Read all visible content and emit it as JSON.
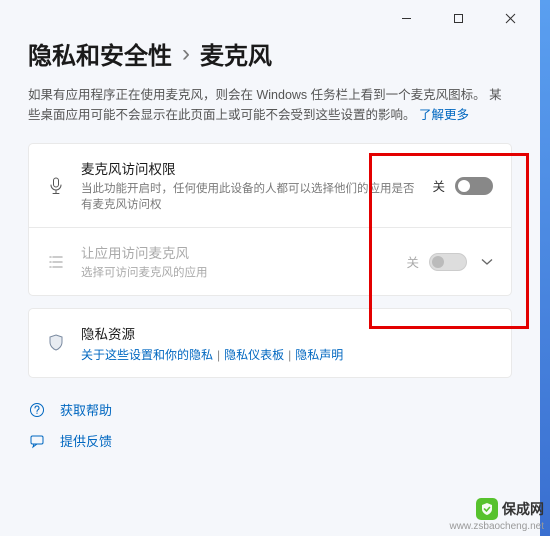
{
  "breadcrumb": {
    "parent": "隐私和安全性",
    "sep": "›",
    "current": "麦克风"
  },
  "description": {
    "text": "如果有应用程序正在使用麦克风，则会在 Windows 任务栏上看到一个麦克风图标。 某些桌面应用可能不会显示在此页面上或可能不会受到这些设置的影响。 ",
    "linkText": "了解更多"
  },
  "cards": {
    "access": {
      "title": "麦克风访问权限",
      "sub": "当此功能开启时，任何使用此设备的人都可以选择他们的应用是否有麦克风访问权",
      "state": "关"
    },
    "apps": {
      "title": "让应用访问麦克风",
      "sub": "选择可访问麦克风的应用",
      "state": "关"
    },
    "resources": {
      "title": "隐私资源",
      "links": [
        "关于这些设置和你的隐私",
        "隐私仪表板",
        "隐私声明"
      ]
    }
  },
  "footer": {
    "help": "获取帮助",
    "feedback": "提供反馈"
  },
  "watermark": {
    "brand": "保成网",
    "url": "www.zsbaocheng.net"
  }
}
